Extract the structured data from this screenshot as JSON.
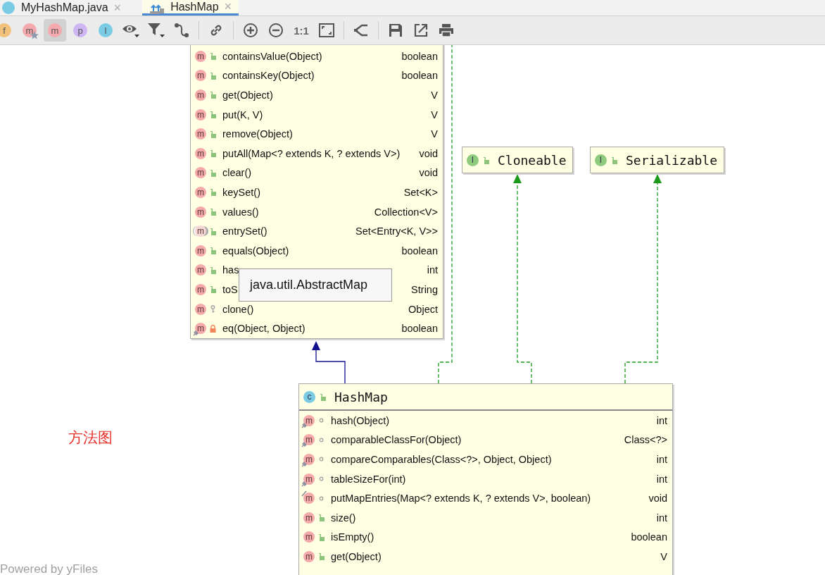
{
  "tabs": [
    {
      "label": "MyHashMap.java",
      "selected": false,
      "close": "×"
    },
    {
      "label": "HashMap",
      "selected": true,
      "close": "×"
    }
  ],
  "toolbar": {
    "filters": [
      {
        "badge": "f",
        "color": "#f2c27c",
        "kind": "plain",
        "selected": false
      },
      {
        "badge": "m",
        "color": "#f3a9ad",
        "kind": "starred",
        "selected": false
      },
      {
        "badge": "m",
        "color": "#f3a9ad",
        "kind": "plain",
        "selected": true
      },
      {
        "badge": "p",
        "color": "#cdb6f2",
        "kind": "plain",
        "selected": false
      },
      {
        "badge": "I",
        "color": "#7ccbe4",
        "kind": "plain",
        "selected": false
      }
    ],
    "zoom_label": "1:1"
  },
  "abstract_map": {
    "members": [
      {
        "badge": "m",
        "name": "containsValue(Object)",
        "type": "boolean",
        "kind": "public"
      },
      {
        "badge": "m",
        "name": "containsKey(Object)",
        "type": "boolean",
        "kind": "public"
      },
      {
        "badge": "m",
        "name": "get(Object)",
        "type": "V",
        "kind": "public"
      },
      {
        "badge": "m",
        "name": "put(K, V)",
        "type": "V",
        "kind": "public"
      },
      {
        "badge": "m",
        "name": "remove(Object)",
        "type": "V",
        "kind": "public"
      },
      {
        "badge": "m",
        "name": "putAll(Map<? extends K, ? extends V>)",
        "type": "void",
        "kind": "public"
      },
      {
        "badge": "m",
        "name": "clear()",
        "type": "void",
        "kind": "public"
      },
      {
        "badge": "m",
        "name": "keySet()",
        "type": "Set<K>",
        "kind": "public"
      },
      {
        "badge": "m",
        "name": "values()",
        "type": "Collection<V>",
        "kind": "public"
      },
      {
        "badge": "m",
        "name": "entrySet()",
        "type": "Set<Entry<K, V>>",
        "kind": "abstract"
      },
      {
        "badge": "m",
        "name": "equals(Object)",
        "type": "boolean",
        "kind": "public"
      },
      {
        "badge": "m",
        "name": "has",
        "type": "int",
        "kind": "public"
      },
      {
        "badge": "m",
        "name": "toS",
        "type": "String",
        "kind": "public"
      },
      {
        "badge": "m",
        "name": "clone()",
        "type": "Object",
        "kind": "protected"
      },
      {
        "badge": "m",
        "name": "eq(Object, Object)",
        "type": "boolean",
        "kind": "private"
      }
    ],
    "tooltip": "java.util.AbstractMap"
  },
  "interfaces": [
    {
      "badge": "I",
      "name": "Cloneable"
    },
    {
      "badge": "I",
      "name": "Serializable"
    }
  ],
  "hash_map": {
    "badge": "c",
    "name": "HashMap",
    "members": [
      {
        "badge": "m",
        "name": "hash(Object)",
        "type": "int",
        "kind": "static"
      },
      {
        "badge": "m",
        "name": "comparableClassFor(Object)",
        "type": "Class<?>",
        "kind": "static"
      },
      {
        "badge": "m",
        "name": "compareComparables(Class<?>, Object, Object)",
        "type": "int",
        "kind": "static"
      },
      {
        "badge": "m",
        "name": "tableSizeFor(int)",
        "type": "int",
        "kind": "static"
      },
      {
        "badge": "m",
        "name": "putMapEntries(Map<? extends K, ? extends V>, boolean)",
        "type": "void",
        "kind": "final"
      },
      {
        "badge": "m",
        "name": "size()",
        "type": "int",
        "kind": "public"
      },
      {
        "badge": "m",
        "name": "isEmpty()",
        "type": "boolean",
        "kind": "public"
      },
      {
        "badge": "m",
        "name": "get(Object)",
        "type": "V",
        "kind": "public"
      }
    ]
  },
  "caption": "方法图",
  "footer": "Powered by yFiles"
}
